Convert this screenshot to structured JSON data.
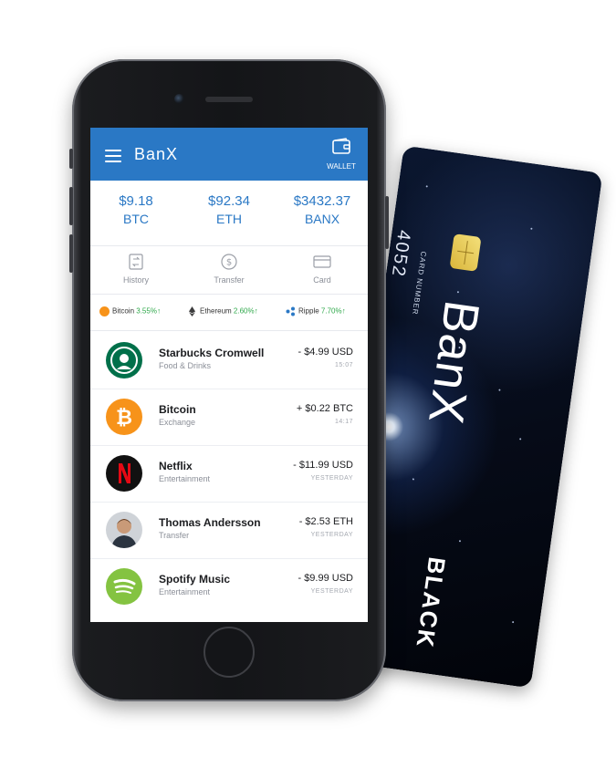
{
  "card": {
    "brand": "BanX",
    "number_label": "CARD NUMBER",
    "number_partial": "4052",
    "tier": "BLACK"
  },
  "header": {
    "title": "BanX",
    "wallet_label": "WALLET",
    "menu_icon": "hamburger-icon",
    "wallet_icon": "wallet-icon",
    "color": "#2a78c5"
  },
  "balances": [
    {
      "amount": "$9.18",
      "currency": "BTC"
    },
    {
      "amount": "$92.34",
      "currency": "ETH"
    },
    {
      "amount": "$3432.37",
      "currency": "BANX"
    }
  ],
  "actions": [
    {
      "label": "History",
      "icon": "history-icon"
    },
    {
      "label": "Transfer",
      "icon": "dollar-icon"
    },
    {
      "label": "Card",
      "icon": "card-icon"
    }
  ],
  "tickers": [
    {
      "name": "Bitcoin",
      "change": "3.55%",
      "arrow": "↑"
    },
    {
      "name": "Ethereum",
      "change": "2.60%",
      "arrow": "↑"
    },
    {
      "name": "Ripple",
      "change": "7.70%",
      "arrow": "↑"
    }
  ],
  "transactions": [
    {
      "name": "Starbucks Cromwell",
      "category": "Food & Drinks",
      "amount": "- $4.99 USD",
      "time": "15:07"
    },
    {
      "name": "Bitcoin",
      "category": "Exchange",
      "amount": "+ $0.22 BTC",
      "time": "14:17"
    },
    {
      "name": "Netflix",
      "category": "Entertainment",
      "amount": "- $11.99 USD",
      "time": "YESTERDAY"
    },
    {
      "name": "Thomas Andersson",
      "category": "Transfer",
      "amount": "- $2.53 ETH",
      "time": "YESTERDAY"
    },
    {
      "name": "Spotify Music",
      "category": "Entertainment",
      "amount": "- $9.99 USD",
      "time": "YESTERDAY"
    }
  ],
  "colors": {
    "accent": "#2a78c5",
    "positive": "#2ea84a",
    "starbucks": "#00704a",
    "bitcoin": "#f7931a",
    "netflix": "#e50914",
    "spotify": "#84c341"
  }
}
